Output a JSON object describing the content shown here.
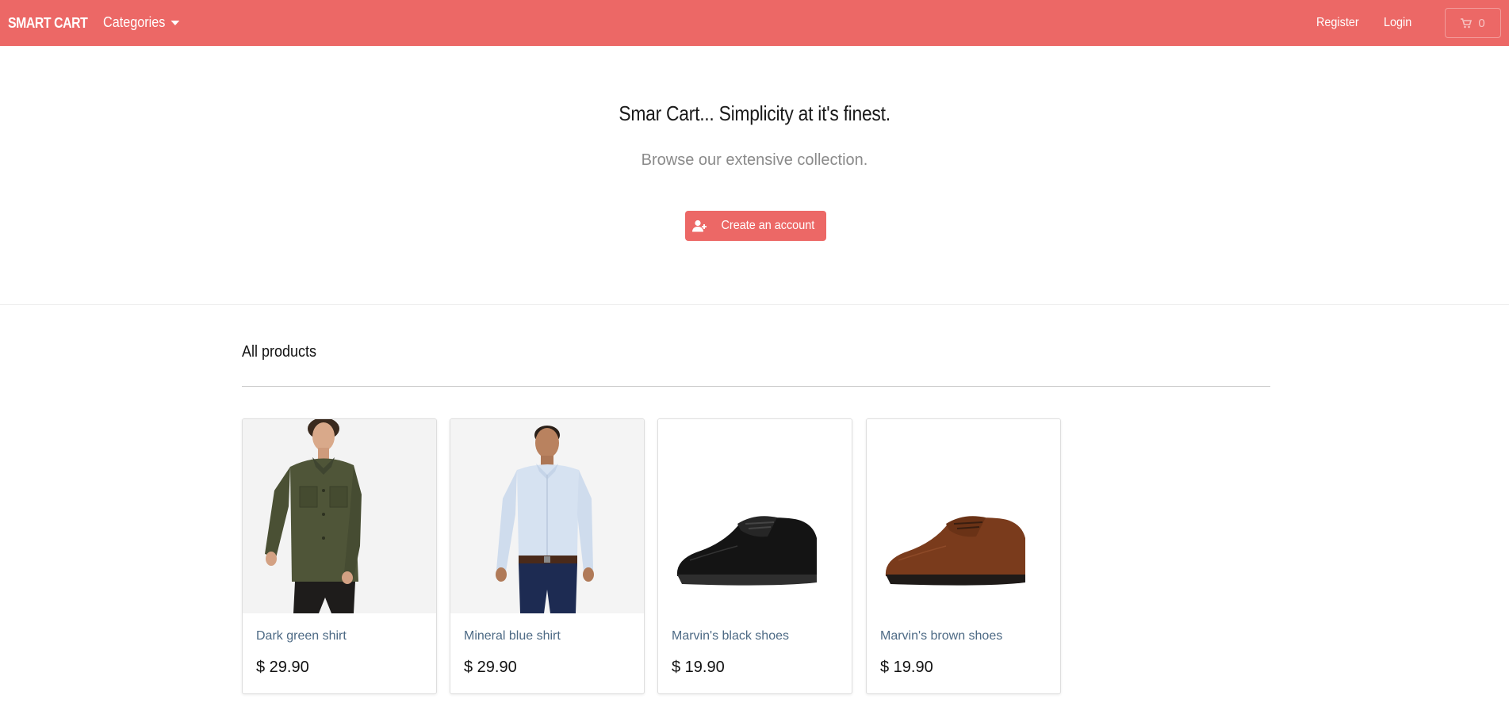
{
  "navbar": {
    "brand": "SMART CART",
    "categories_label": "Categories",
    "register_label": "Register",
    "login_label": "Login",
    "cart_count": "0"
  },
  "hero": {
    "title": "Smar Cart... Simplicity at it's finest.",
    "subtitle": "Browse our extensive collection.",
    "create_account_label": "Create an account"
  },
  "products": {
    "heading": "All products",
    "items": [
      {
        "name": "Dark green shirt",
        "price": "$ 29.90"
      },
      {
        "name": "Mineral blue shirt",
        "price": "$ 29.90"
      },
      {
        "name": "Marvin's black shoes",
        "price": "$ 19.90"
      },
      {
        "name": "Marvin's brown shoes",
        "price": "$ 19.90"
      }
    ]
  },
  "colors": {
    "accent": "#ec6866",
    "product_name": "#4d6a85"
  }
}
